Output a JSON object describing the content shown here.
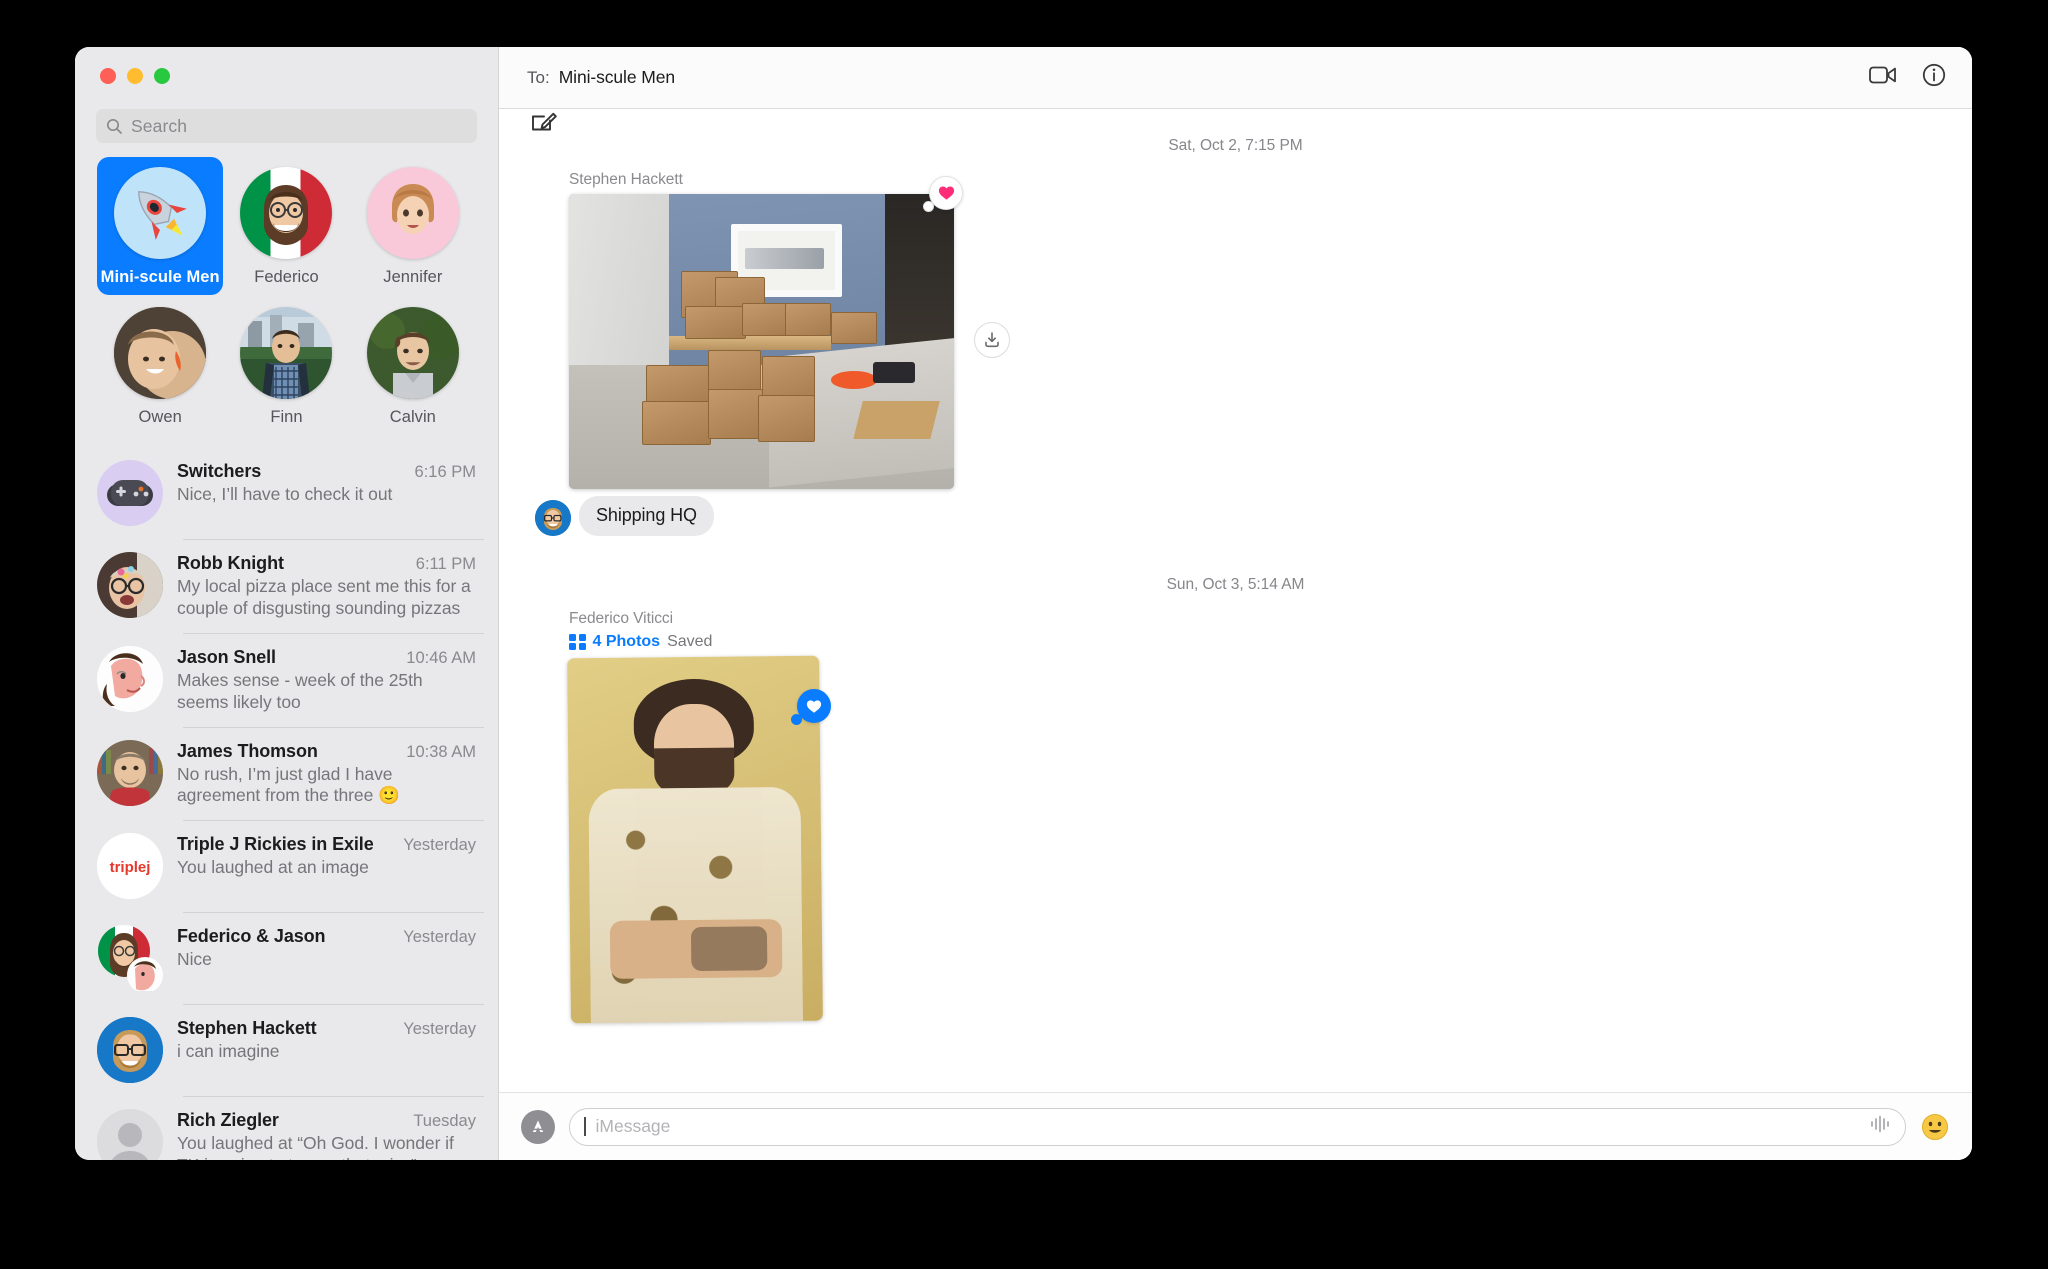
{
  "window": {
    "traffic_lights": [
      "close",
      "minimize",
      "zoom"
    ],
    "compose_icon": "compose-pencil-icon"
  },
  "sidebar": {
    "search": {
      "placeholder": "Search",
      "icon": "search-icon"
    },
    "pinned": [
      {
        "name": "Mini-scule Men",
        "avatar": "rocket-emoji",
        "selected": true
      },
      {
        "name": "Federico",
        "avatar": "memoji-beard-glasses",
        "selected": false
      },
      {
        "name": "Jennifer",
        "avatar": "memoji-short-hair",
        "selected": false
      },
      {
        "name": "Owen",
        "avatar": "photo-boy-smiling",
        "selected": false
      },
      {
        "name": "Finn",
        "avatar": "photo-boy-cityscape",
        "selected": false
      },
      {
        "name": "Calvin",
        "avatar": "photo-teen-outdoors",
        "selected": false
      }
    ],
    "conversations": [
      {
        "name": "Switchers",
        "time": "6:16 PM",
        "preview": "Nice, I’ll have to check it out",
        "avatar": "game-controller-emoji"
      },
      {
        "name": "Robb Knight",
        "time": "6:11 PM",
        "preview": "My local pizza place sent me this for a couple of disgusting sounding pizzas",
        "avatar": "photo-man-glasses"
      },
      {
        "name": "Jason Snell",
        "time": "10:46 AM",
        "preview": "Makes sense - week of the 25th seems likely too",
        "avatar": "cartoon-man-profile"
      },
      {
        "name": "James Thomson",
        "time": "10:38 AM",
        "preview": "No rush, I’m just glad I have agreement from the three 🙂",
        "avatar": "photo-man-bookshelf"
      },
      {
        "name": "Triple J Rickies in Exile",
        "time": "Yesterday",
        "preview": "You laughed at an image",
        "avatar": "triplej-logo"
      },
      {
        "name": "Federico & Jason",
        "time": "Yesterday",
        "preview": "Nice",
        "avatar": "group-two-memoji"
      },
      {
        "name": "Stephen Hackett",
        "time": "Yesterday",
        "preview": "i can imagine",
        "avatar": "memoji-blue-glasses"
      },
      {
        "name": "Rich Ziegler",
        "time": "Tuesday",
        "preview": "You laughed at “Oh God.  I wonder if TK is going to tee up that mi…”",
        "avatar": "default-person-silhouette"
      }
    ]
  },
  "chat": {
    "to_label": "To:",
    "to_value": "Mini-scule Men",
    "header_icons": [
      "facetime-video-icon",
      "info-icon"
    ],
    "groups": [
      {
        "date_separator": "Sat, Oct 2, 7:15 PM",
        "sender": "Stephen Hackett",
        "attachment": "photo-shipping-room-boxes",
        "reaction": "heart-pink",
        "download_icon": "download-icon",
        "bubble_text": "Shipping HQ",
        "bubble_avatar": "memoji-blue-glasses"
      },
      {
        "date_separator": "Sun, Oct 3, 5:14 AM",
        "sender": "Federico Viticci",
        "saved_count": "4 Photos",
        "saved_word": "Saved",
        "saved_icon": "photo-grid-icon",
        "attachment": "photo-man-floral-shirt-portrait",
        "reaction": "heart-blue"
      }
    ]
  },
  "input": {
    "appstore_icon": "app-store-icon",
    "placeholder": "iMessage",
    "value": "",
    "audio_icon": "audio-waveform-icon",
    "emoji_icon": "emoji-smiley-icon"
  },
  "colors": {
    "accent": "#0a7cff",
    "sidebar_bg": "#e9e9eb",
    "bubble_bg": "#e9e9eb",
    "heart_pink": "#ff2d78"
  }
}
